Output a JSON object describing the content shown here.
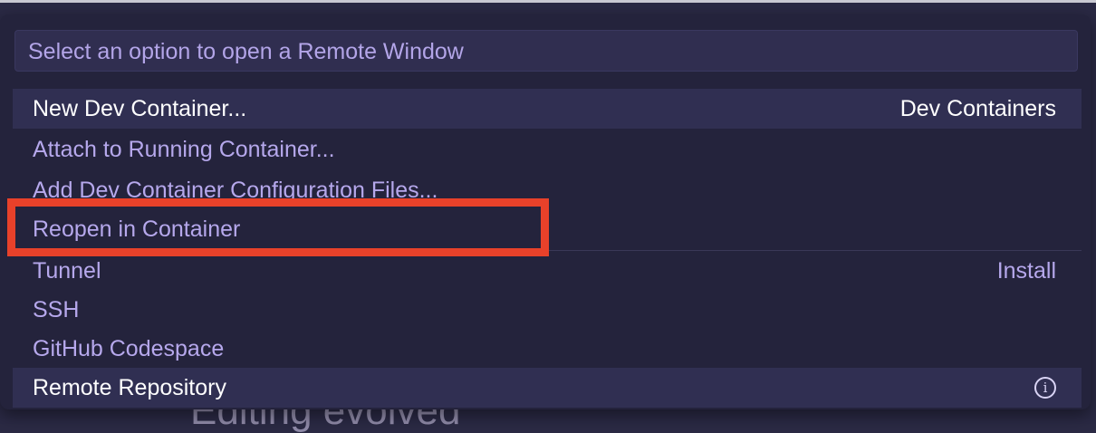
{
  "palette": {
    "placeholder": "Select an option to open a Remote Window",
    "items": [
      {
        "label": "New Dev Container...",
        "detail": "Dev Containers"
      },
      {
        "label": "Attach to Running Container...",
        "detail": ""
      },
      {
        "label": "Add Dev Container Configuration Files...",
        "detail": ""
      },
      {
        "label": "Reopen in Container",
        "detail": ""
      },
      {
        "label": "Tunnel",
        "detail": "Install"
      },
      {
        "label": "SSH",
        "detail": ""
      },
      {
        "label": "GitHub Codespace",
        "detail": ""
      },
      {
        "label": "Remote Repository",
        "detail": ""
      }
    ],
    "info_glyph": "i"
  },
  "background": {
    "partial_text": "Editing evolved"
  },
  "colors": {
    "annotation": "#e8412a",
    "accent_text": "#b6a8ec",
    "panel": "#24233c"
  }
}
